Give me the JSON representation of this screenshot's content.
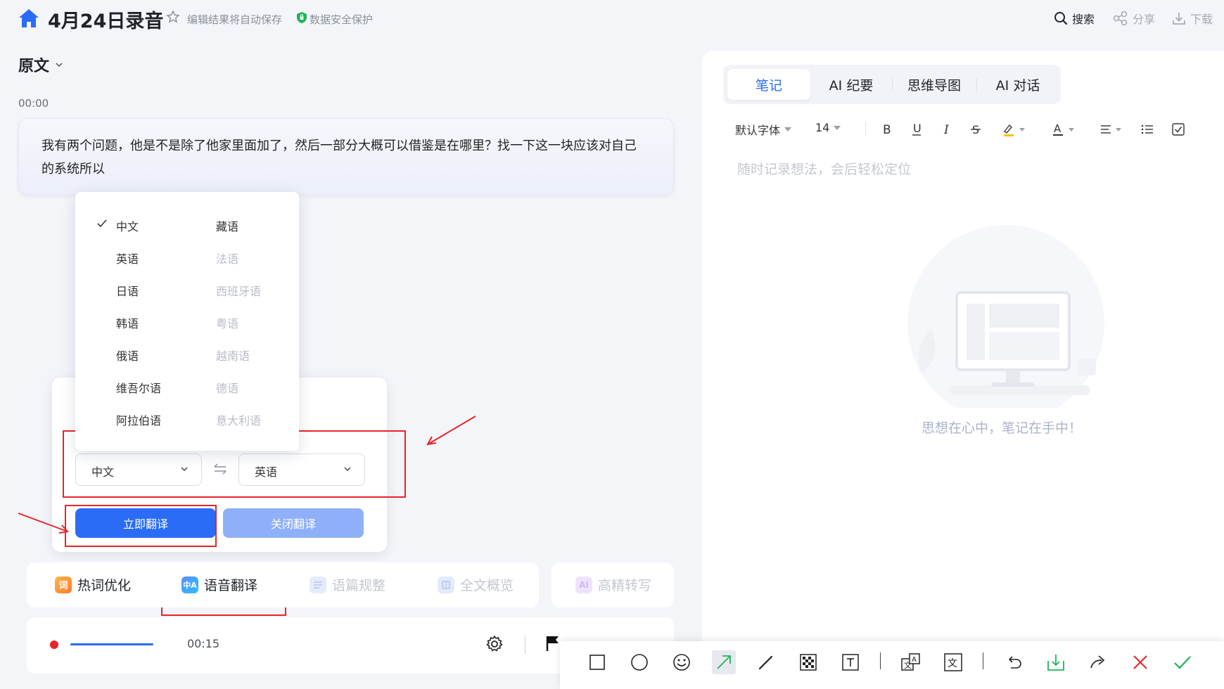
{
  "header": {
    "title": "4月24日录音",
    "autosave": "编辑结果将自动保存",
    "secure": "数据安全保护",
    "search": "搜索",
    "share": "分享",
    "download": "下载"
  },
  "left": {
    "section_label": "原文",
    "timestamp": "00:00",
    "transcript": "我有两个问题，他是不是除了他家里面加了，然后一部分大概可以借鉴是在哪里？找一下这一块应该对自己的系统所以"
  },
  "language_menu": {
    "col1": [
      "中文",
      "英语",
      "日语",
      "韩语",
      "俄语",
      "维吾尔语",
      "阿拉伯语"
    ],
    "col2": [
      "藏语",
      "法语",
      "西班牙语",
      "粤语",
      "越南语",
      "德语",
      "意大利语"
    ],
    "selected": "中文"
  },
  "translation": {
    "source": "中文",
    "target": "英语",
    "translate_now": "立即翻译",
    "close_translate": "关闭翻译"
  },
  "tools": {
    "hotword": "热词优化",
    "hotword_icon_text": "词",
    "voice_translate": "语音翻译",
    "voice_translate_icon_text": "中A",
    "discourse": "语篇规整",
    "overview": "全文概览",
    "hq_transcribe": "高精转写",
    "hq_icon_text": "AI"
  },
  "player": {
    "time": "00:15"
  },
  "right": {
    "tabs": [
      "笔记",
      "AI 纪要",
      "思维导图",
      "AI 对话"
    ],
    "active_tab": "笔记",
    "font_family": "默认字体",
    "font_size": "14",
    "placeholder": "随时记录想法，会后轻松定位",
    "empty_text": "思想在心中，笔记在手中！"
  },
  "colors": {
    "primary": "#2a6cf6",
    "primary_disabled": "#8fb0f9",
    "annotation_red": "#e8242a"
  }
}
